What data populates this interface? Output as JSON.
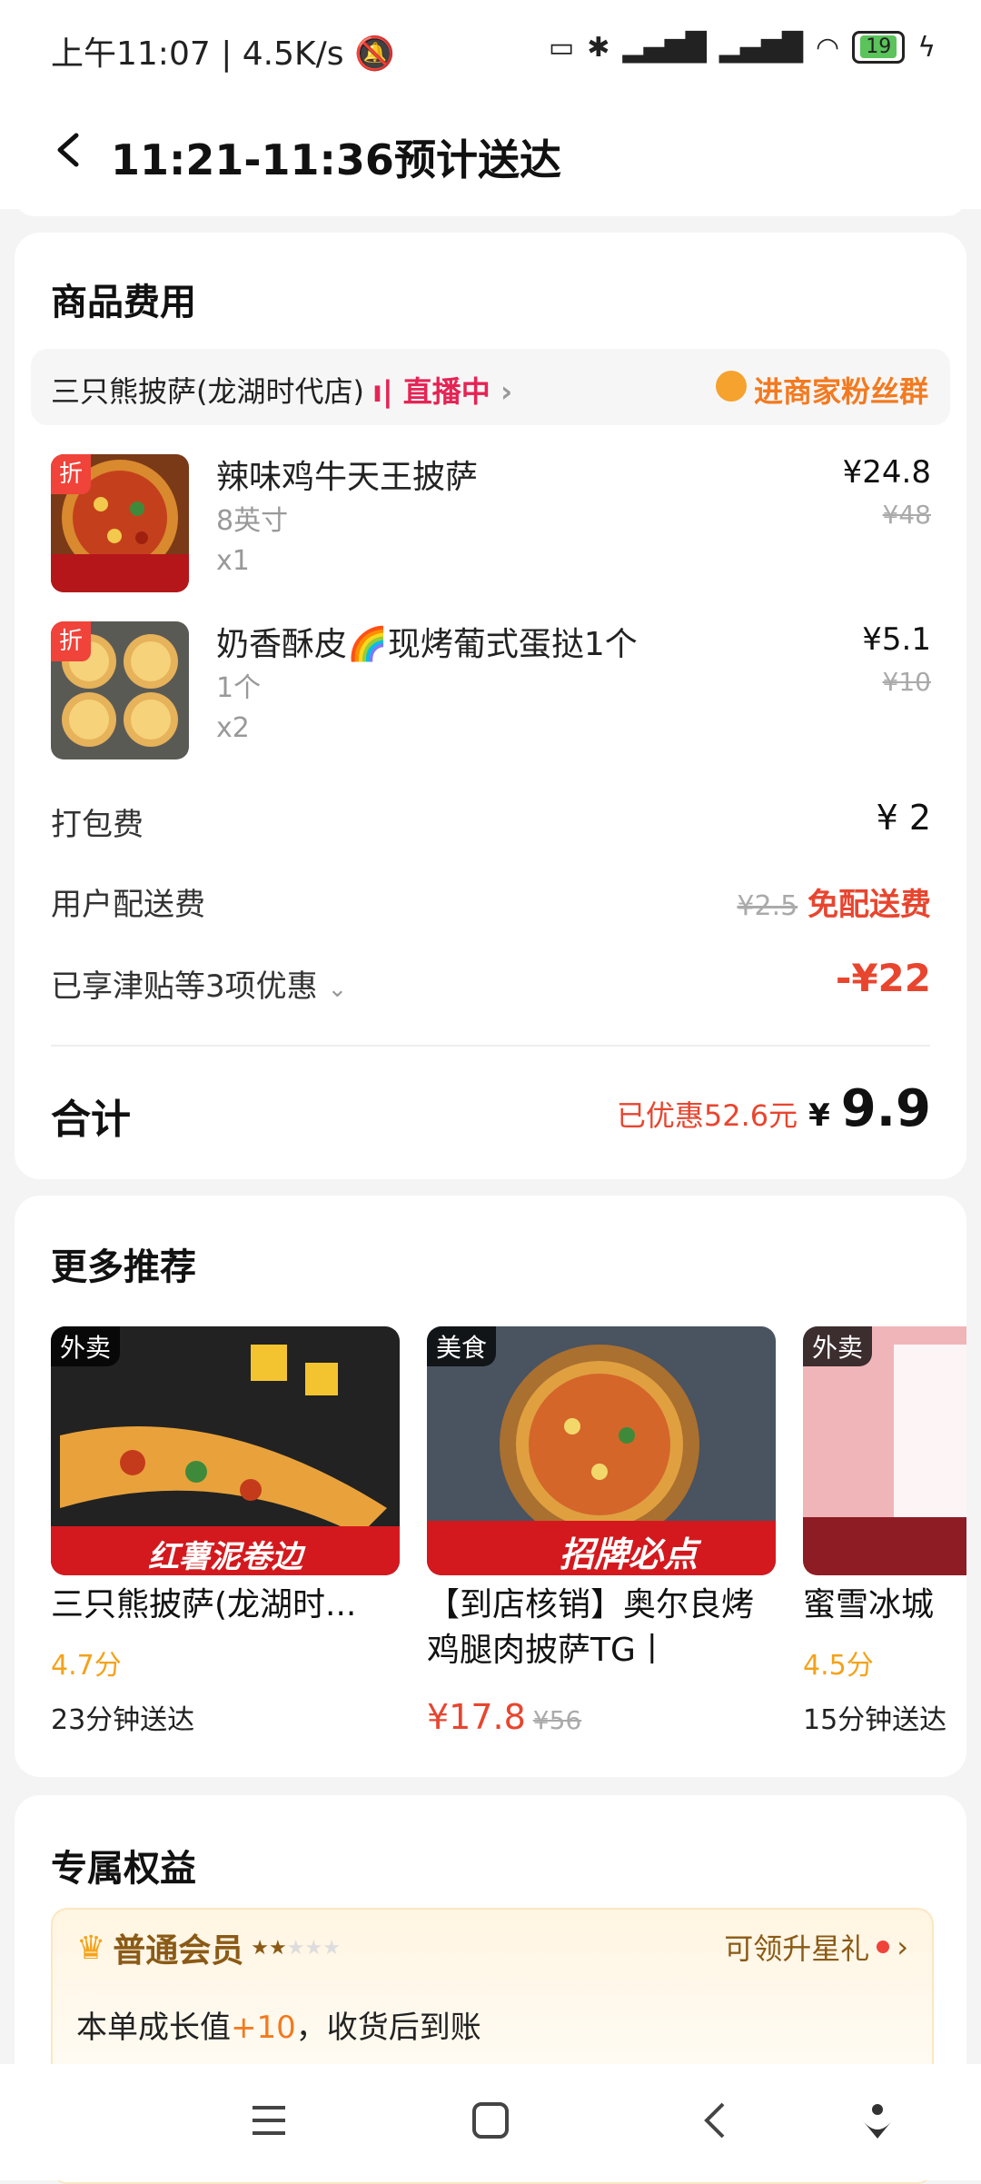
{
  "status_bar": {
    "time": "上午11:07",
    "speed": "4.5K/s",
    "battery": "19"
  },
  "header": {
    "title": "11:21-11:36预计送达"
  },
  "goods": {
    "title": "商品费用",
    "shop": {
      "name": "三只熊披萨(龙湖时代店)",
      "live": "直播中",
      "fans_group": "进商家粉丝群"
    },
    "items": [
      {
        "name": "辣味鸡牛天王披萨",
        "spec": "8英寸",
        "qty": "x1",
        "price": "¥24.8",
        "original": "¥48",
        "badge": "折"
      },
      {
        "name": "奶香酥皮🌈现烤葡式蛋挞1个",
        "spec": "1个",
        "qty": "x2",
        "price": "¥5.1",
        "original": "¥10",
        "badge": "折"
      }
    ],
    "packing": {
      "label": "打包费",
      "value": "¥ 2"
    },
    "delivery": {
      "label": "用户配送费",
      "original": "¥2.5",
      "value": "免配送费"
    },
    "discounts": {
      "label": "已享津贴等3项优惠",
      "value": "-¥22"
    },
    "total": {
      "label": "合计",
      "saved": "已优惠52.6元",
      "currency": "¥",
      "amount": "9.9"
    }
  },
  "recommend": {
    "title": "更多推荐",
    "cards": [
      {
        "tag": "外卖",
        "img_text": "红薯泥卷边",
        "name": "三只熊披萨(龙湖时...",
        "score": "4.7分",
        "eta": "23分钟送达"
      },
      {
        "tag": "美食",
        "img_text": "招牌必点",
        "name": "【到店核销】奥尔良烤鸡腿肉披萨TG丨",
        "price": "¥17.8",
        "original": "¥56"
      },
      {
        "tag": "外卖",
        "name": "蜜雪冰城",
        "score": "4.5分",
        "eta": "15分钟送达"
      }
    ]
  },
  "benefits": {
    "title": "专属权益",
    "member": "普通会员",
    "upgrade": "可领升星礼",
    "growth_prefix": "本单成长值",
    "growth_value": "+10",
    "growth_suffix": "，收货后到账"
  },
  "colors": {
    "accent_red": "#e8452f",
    "accent_orange": "#f37a20",
    "live_pink": "#e52455",
    "score_yellow": "#f4a21a"
  }
}
